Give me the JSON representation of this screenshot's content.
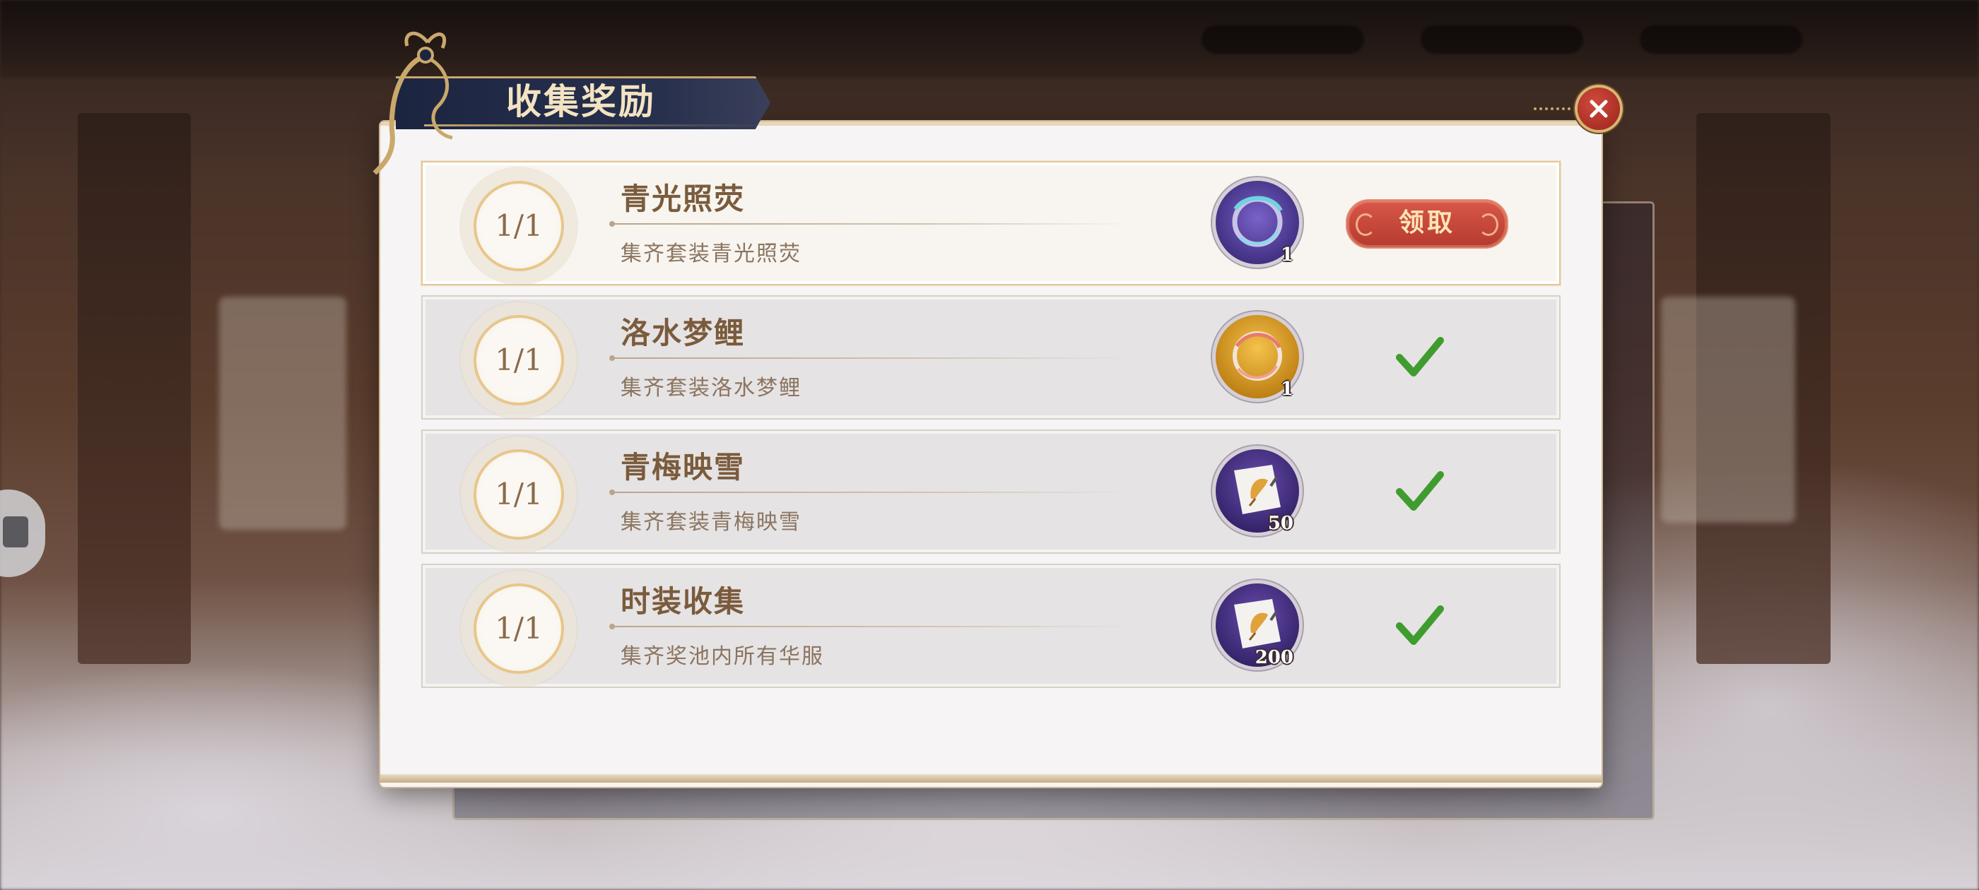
{
  "dialog": {
    "title": "收集奖励",
    "close_icon": "close-icon"
  },
  "rewards": [
    {
      "progress": "1/1",
      "title": "青光照荧",
      "description": "集齐套装青光照荧",
      "item_icon": "blue-ring-icon",
      "count": "1",
      "status": "claimable",
      "claim_label": "领取"
    },
    {
      "progress": "1/1",
      "title": "洛水梦鲤",
      "description": "集齐套装洛水梦鲤",
      "item_icon": "gold-ring-icon",
      "count": "1",
      "status": "claimed"
    },
    {
      "progress": "1/1",
      "title": "青梅映雪",
      "description": "集齐套装青梅映雪",
      "item_icon": "ginkgo-scroll-icon",
      "count": "50",
      "status": "claimed"
    },
    {
      "progress": "1/1",
      "title": "时装收集",
      "description": "集齐奖池内所有华服",
      "item_icon": "ginkgo-scroll-icon",
      "count": "200",
      "status": "claimed"
    }
  ],
  "colors": {
    "claim_button": "#c4483a",
    "check": "#3f9c2e",
    "title_tab": "#1c2540",
    "accent_gold": "#c9a86c"
  }
}
